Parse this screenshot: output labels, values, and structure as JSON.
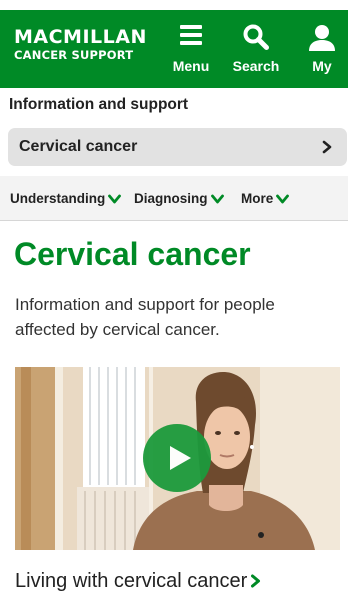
{
  "header": {
    "logo_line1": "MACMILLAN",
    "logo_line2": "CANCER SUPPORT",
    "menu_label": "Menu",
    "search_label": "Search",
    "account_label": "My",
    "brand_color": "#008a26"
  },
  "info_bar": {
    "label": "Information and support"
  },
  "topic_selector": {
    "label": "Cervical cancer",
    "icon": "chevron-right-icon"
  },
  "section_tabs": [
    {
      "label": "Understanding",
      "icon": "chevron-down-icon"
    },
    {
      "label": "Diagnosing",
      "icon": "chevron-down-icon"
    },
    {
      "label": "More",
      "icon": "chevron-down-icon"
    }
  ],
  "main": {
    "title": "Cervical cancer",
    "intro": "Information and support for people affected by cervical cancer.",
    "video": {
      "icon": "play-icon"
    },
    "link_label": "Living with cervical cancer"
  }
}
